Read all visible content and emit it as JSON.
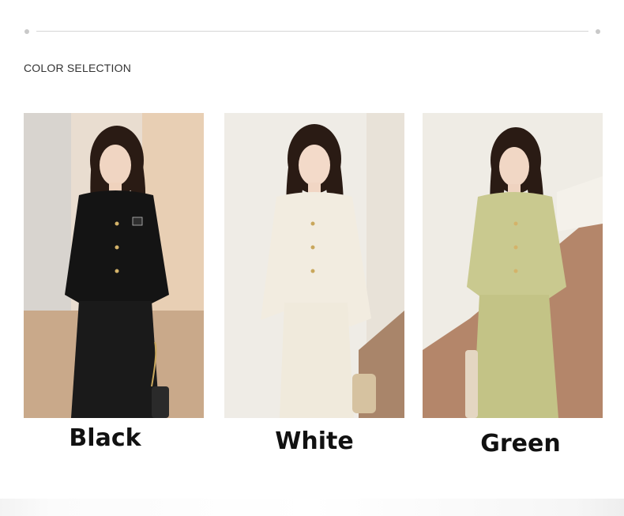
{
  "section_title": "COLOR SELECTION",
  "options": [
    {
      "label": "Black",
      "color": "#141414",
      "accent": "#2a2a2a"
    },
    {
      "label": "White",
      "color": "#f2ece0",
      "accent": "#e6dccb"
    },
    {
      "label": "Green",
      "color": "#c9c98f",
      "accent": "#b8b87c"
    }
  ]
}
